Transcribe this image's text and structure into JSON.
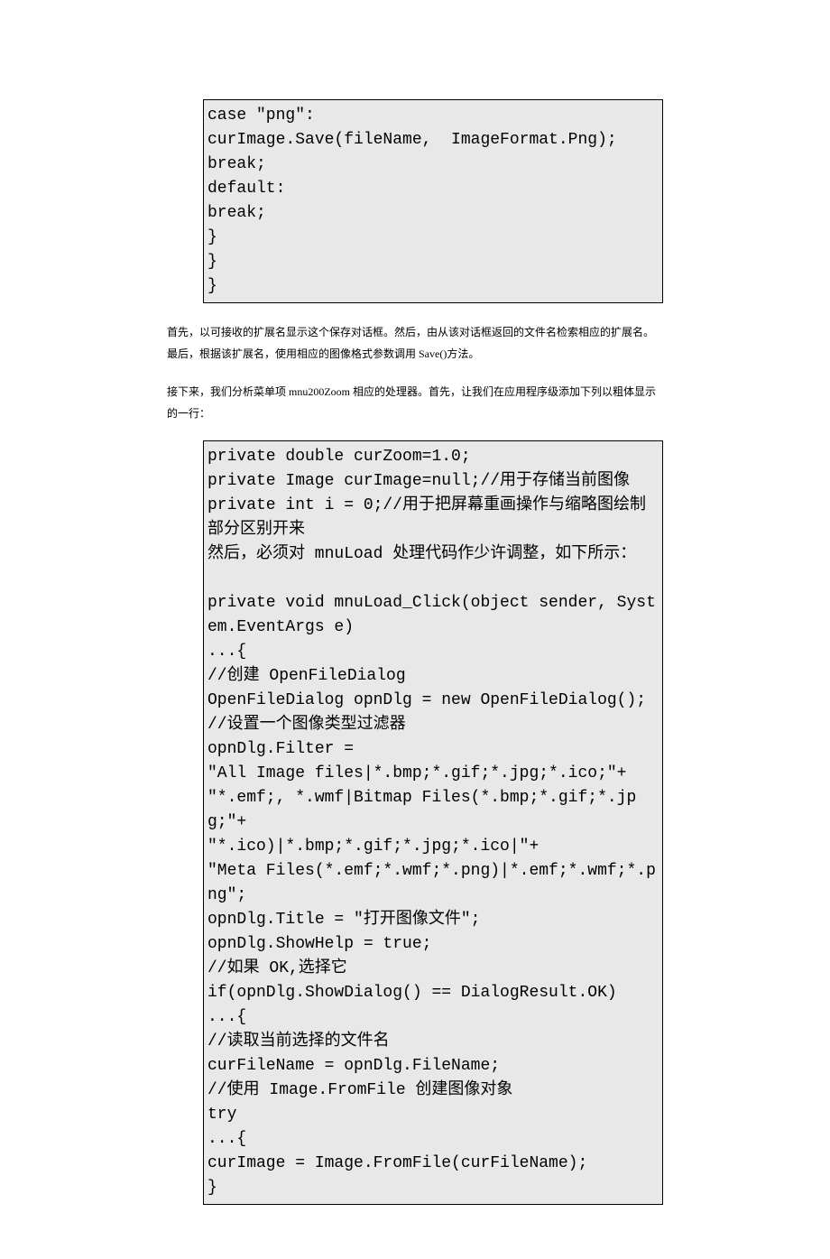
{
  "codeBlock1": "case \"png\":\ncurImage.Save(fileName,  ImageFormat.Png);\nbreak;\ndefault:\nbreak;\n}\n}\n}",
  "prose1": "首先，以可接收的扩展名显示这个保存对话框。然后，由从该对话框返回的文件名检索相应的扩展名。最后，根据该扩展名，使用相应的图像格式参数调用 Save()方法。",
  "prose2": "接下来，我们分析菜单项 mnu200Zoom 相应的处理器。首先，让我们在应用程序级添加下列以粗体显示的一行：",
  "codeBlock2": "private double curZoom=1.0;\nprivate Image curImage=null;//用于存储当前图像\nprivate int i = 0;//用于把屏幕重画操作与缩略图绘制部分区别开来\n然后，必须对 mnuLoad 处理代码作少许调整，如下所示：\n\nprivate void mnuLoad_Click(object sender, System.EventArgs e)\n...{\n//创建 OpenFileDialog\nOpenFileDialog opnDlg = new OpenFileDialog();\n//设置一个图像类型过滤器\nopnDlg.Filter =\n\"All Image files|*.bmp;*.gif;*.jpg;*.ico;\"+\n\"*.emf;, *.wmf|Bitmap Files(*.bmp;*.gif;*.jpg;\"+\n\"*.ico)|*.bmp;*.gif;*.jpg;*.ico|\"+\n\"Meta Files(*.emf;*.wmf;*.png)|*.emf;*.wmf;*.png\";\nopnDlg.Title = \"打开图像文件\";\nopnDlg.ShowHelp = true;\n//如果 OK,选择它\nif(opnDlg.ShowDialog() == DialogResult.OK)\n...{\n//读取当前选择的文件名\ncurFileName = opnDlg.FileName;\n//使用 Image.FromFile 创建图像对象\ntry\n...{\ncurImage = Image.FromFile(curFileName);\n}"
}
